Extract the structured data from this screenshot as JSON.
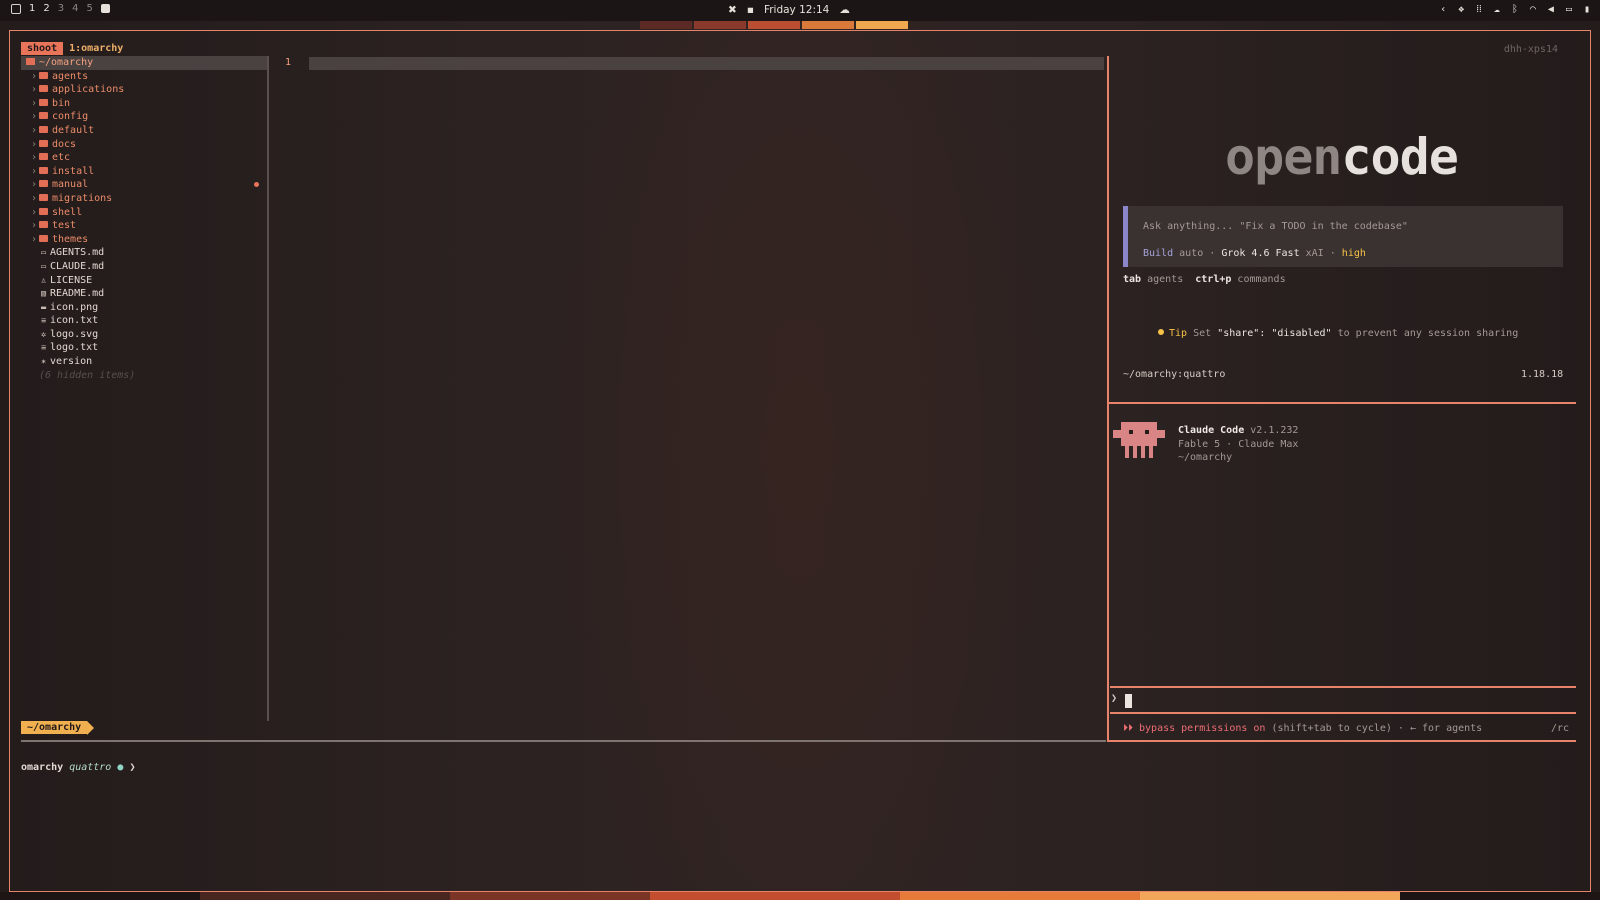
{
  "topbar": {
    "workspaces": [
      "1",
      "2",
      "3",
      "4",
      "5"
    ],
    "clock": "Friday 12:14",
    "colors": {
      "bar": "#1b1615",
      "accent": "#e8745a"
    }
  },
  "tmux": {
    "session": "shoot",
    "window": "1:omarchy",
    "host": "dhh-xps14"
  },
  "tree": {
    "root": "~/omarchy",
    "dirs": [
      "agents",
      "applications",
      "bin",
      "config",
      "default",
      "docs",
      "etc",
      "install",
      "manual",
      "migrations",
      "shell",
      "test",
      "themes"
    ],
    "files": [
      {
        "name": "AGENTS.md",
        "icon": "markdown-icon",
        "glyph": "▭"
      },
      {
        "name": "CLAUDE.md",
        "icon": "markdown-icon",
        "glyph": "▭"
      },
      {
        "name": "LICENSE",
        "icon": "license-icon",
        "glyph": "♙"
      },
      {
        "name": "README.md",
        "icon": "readme-icon",
        "glyph": "▧"
      },
      {
        "name": "icon.png",
        "icon": "image-icon",
        "glyph": "▬"
      },
      {
        "name": "icon.txt",
        "icon": "text-icon",
        "glyph": "≡"
      },
      {
        "name": "logo.svg",
        "icon": "svg-icon",
        "glyph": "✲"
      },
      {
        "name": "logo.txt",
        "icon": "text-icon",
        "glyph": "≡"
      },
      {
        "name": "version",
        "icon": "star-icon",
        "glyph": "✶"
      }
    ],
    "hidden": "(6 hidden items)"
  },
  "editor": {
    "line_number": "1"
  },
  "status": {
    "path": "~/omarchy"
  },
  "shell": {
    "user": "omarchy",
    "branch": "quattro",
    "dot": "●",
    "arrow": "❯"
  },
  "opencode": {
    "logo_a": "open",
    "logo_b": "code",
    "placeholder": "Ask anything... \"Fix a TODO in the codebase\"",
    "mode": "Build",
    "mode_value": "auto",
    "sep": "·",
    "model": "Grok 4.6 Fast",
    "provider": "xAI",
    "level": "high",
    "hint1_key": "tab",
    "hint1": "agents",
    "hint2_key": "ctrl+p",
    "hint2": "commands",
    "tip_label": "Tip",
    "tip_pre": "Set",
    "tip_code": "\"share\": \"disabled\"",
    "tip_post": "to prevent any session sharing",
    "cwd": "~/omarchy:quattro",
    "version": "1.18.18"
  },
  "claude": {
    "title": "Claude Code",
    "version": "v2.1.232",
    "model": "Fable 5 · Claude Max",
    "dir": "~/omarchy",
    "prompt": "❯",
    "bypass": "⏵⏵ bypass permissions on",
    "bypass_hint": "(shift+tab to cycle) · ← for agents",
    "cmd": "/rc"
  }
}
